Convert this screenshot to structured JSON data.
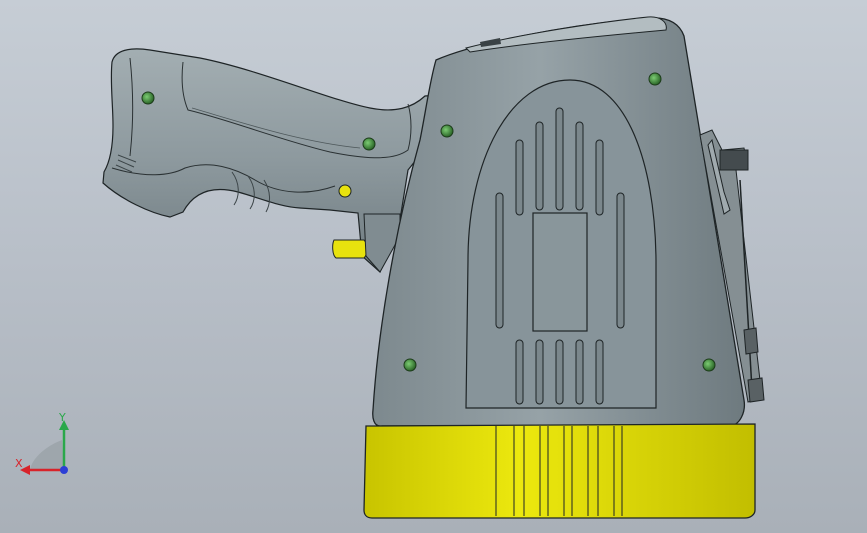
{
  "viewport": {
    "background_top": "#c6cdd5",
    "background_bottom": "#a9b0b8"
  },
  "model": {
    "body_color": "#8f9ba0",
    "body_shadow_color": "#6f7b80",
    "base_color": "#e3e00a",
    "base_shadow_color": "#b9b500",
    "trigger_color": "#e8e20e",
    "screw_color": "#3d8a3a",
    "outline_color": "#1e2426"
  },
  "triad": {
    "x_axis": {
      "label": "X",
      "color": "#d8232a"
    },
    "y_axis": {
      "label": "Y",
      "color": "#2aa84a"
    },
    "z_axis": {
      "color": "#2c3fd6"
    }
  }
}
